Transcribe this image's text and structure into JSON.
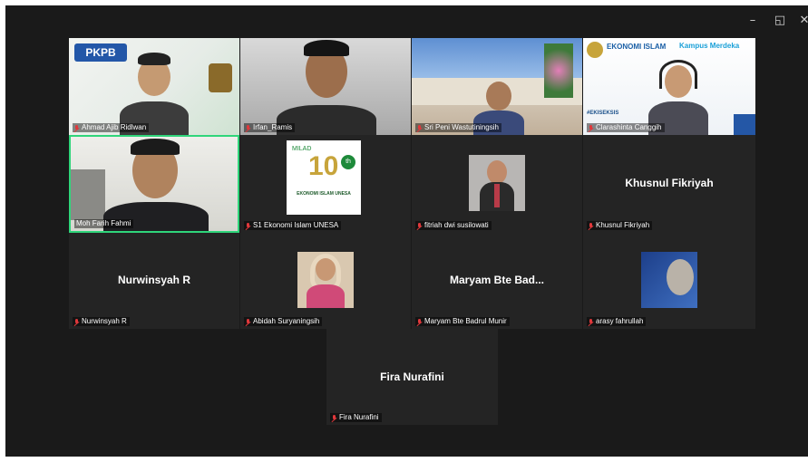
{
  "window_controls": {
    "minimize": "–",
    "restore": "◱",
    "close": "✕"
  },
  "participants": [
    {
      "name": "Ahmad Ajib Ridlwan",
      "muted": true
    },
    {
      "name": "Irfan_Ramis",
      "muted": true
    },
    {
      "name": "Sri Peni Wastutiningsih",
      "muted": true
    },
    {
      "name": "Clarashinta Canggih",
      "muted": true
    },
    {
      "name": "Moh Farih Fahmi",
      "muted": false,
      "active_speaker": true
    },
    {
      "name": "S1 Ekonomi Islam UNESA",
      "muted": true
    },
    {
      "name": "fitriah dwi susilowati",
      "muted": true
    },
    {
      "name": "Khusnul Fikriyah",
      "muted": true,
      "display": "Khusnul Fikriyah"
    },
    {
      "name": "Nurwinsyah R",
      "muted": true,
      "display": "Nurwinsyah R"
    },
    {
      "name": "Abidah Suryaningsih",
      "muted": true
    },
    {
      "name": "Maryam Bte Badrul Munir",
      "muted": true,
      "display": "Maryam Bte Bad..."
    },
    {
      "name": "arasy fahrullah",
      "muted": true
    },
    {
      "name": "Fira Nurafini",
      "muted": true,
      "display": "Fira Nurafini"
    }
  ],
  "overlays": {
    "pkpb_logo": "PKPB",
    "ekonomi_islam": "EKONOMI ISLAM",
    "kampus_merdeka": "Kampus Merdeka",
    "eki_tag": "#EKISEKSIS",
    "unesa_line1": "MILAD",
    "unesa_line2": "10",
    "unesa_line3": "th",
    "unesa_line4": "EKONOMI ISLAM UNESA"
  },
  "colors": {
    "background": "#1a1a1a",
    "tile": "#242424",
    "active_border": "#2fd57a",
    "mic_muted": "#e0383b"
  }
}
